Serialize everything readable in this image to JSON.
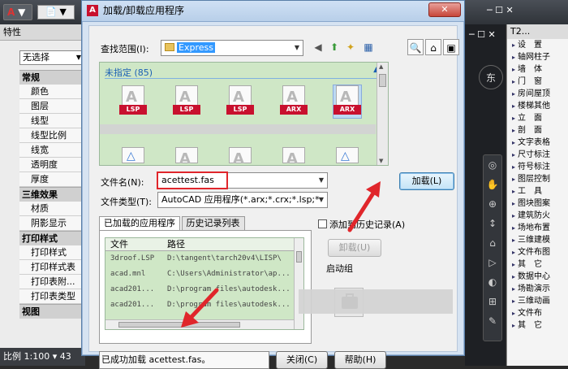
{
  "app": {
    "menu_button": "▼",
    "quick_access": "📄 ▼",
    "top_controls": "─ ☐ ✕",
    "drawing_controls": "─ ☐ ✕"
  },
  "properties_palette": {
    "title": "特性",
    "selection": "无选择",
    "sections": [
      {
        "label": "常规",
        "rows": [
          "颜色",
          "图层",
          "线型",
          "线型比例",
          "线宽",
          "透明度",
          "厚度"
        ]
      },
      {
        "label": "三维效果",
        "rows": [
          "材质",
          "阴影显示"
        ]
      },
      {
        "label": "打印样式",
        "rows": [
          "打印样式",
          "打印样式表",
          "打印表附...",
          "打印表类型"
        ]
      },
      {
        "label": "视图",
        "rows": []
      }
    ]
  },
  "status_bar": {
    "scale": "比例 1:100 ▾  43"
  },
  "nav_cube_label": "东",
  "nav_tools": [
    "◎",
    "✋",
    "⊕",
    "↕",
    "⌂",
    "▷",
    "◐",
    "⊞",
    "✎"
  ],
  "right_palette": {
    "title": "T2...",
    "items": [
      "设　置",
      "轴网柱子",
      "墙　体",
      "门　窗",
      "房间屋顶",
      "楼梯其他",
      "立　面",
      "剖　面",
      "文字表格",
      "尺寸标注",
      "符号标注",
      "图层控制",
      "工　具",
      "图块图案",
      "建筑防火",
      "场地布置",
      "三维建模",
      "文件布图",
      "其　它",
      "数据中心",
      "场勘演示",
      "三维动画",
      "文件布",
      "其　它"
    ]
  },
  "dialog": {
    "title": "加载/卸载应用程序",
    "close_label": "✕",
    "look_in_label": "查找范围(I):",
    "look_in_value": "Express",
    "toolbar_icons": [
      "back-icon",
      "up-folder-icon",
      "new-folder-icon",
      "views-icon"
    ],
    "right_tools": [
      "🔍",
      "⌂",
      "▣"
    ],
    "group_header": "未指定 (85)",
    "files_row1": [
      {
        "tag": "LSP"
      },
      {
        "tag": "LSP"
      },
      {
        "tag": "LSP"
      },
      {
        "tag": "ARX"
      },
      {
        "tag": "ARX"
      }
    ],
    "file_name_label": "文件名(N):",
    "file_name_value": "acettest.fas",
    "file_type_label": "文件类型(T):",
    "file_type_value": "AutoCAD 应用程序(*.arx;*.crx;*.lsp;*",
    "load_button": "加载(L)",
    "tabs": [
      "已加载的应用程序",
      "历史记录列表"
    ],
    "list_columns": [
      "文件",
      "路径"
    ],
    "list_rows": [
      {
        "file": "3droof.LSP",
        "path": "D:\\tangent\\tarch20v4\\LISP\\"
      },
      {
        "file": "acad.mnl",
        "path": "C:\\Users\\Administrator\\ap..."
      },
      {
        "file": "acad201...",
        "path": "D:\\program files\\autodesk..."
      },
      {
        "file": "acad201...",
        "path": "D:\\program files\\autodesk..."
      }
    ],
    "add_history_label": "添加到历史记录(A)",
    "unload_button": "卸载(U)",
    "startup_suite_label": "启动组",
    "status_message": "已成功加载 acettest.fas。",
    "close_button": "关闭(C)",
    "help_button": "帮助(H)"
  }
}
